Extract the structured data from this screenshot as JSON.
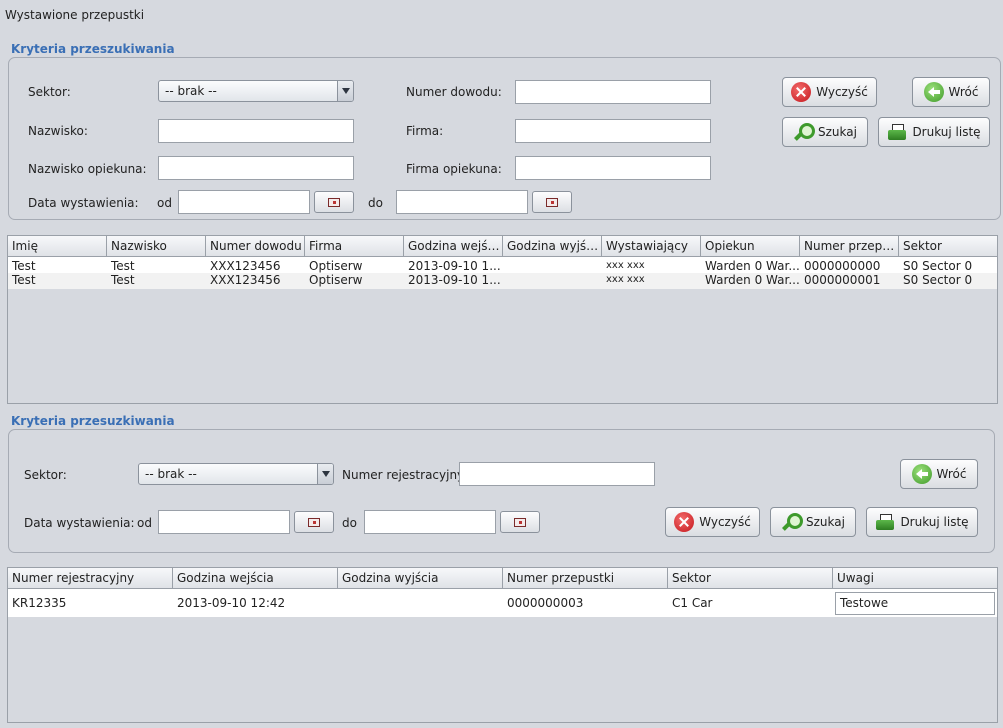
{
  "window": {
    "title": "Wystawione przepustki"
  },
  "passes_search": {
    "title": "Kryteria przeszukiwania",
    "sector_label": "Sektor:",
    "sector_value": "-- brak --",
    "surname_label": "Nazwisko:",
    "surname_value": "",
    "guardian_surname_label": "Nazwisko opiekuna:",
    "guardian_surname_value": "",
    "issue_date_label": "Data wystawienia:",
    "from_label": "od",
    "to_label": "do",
    "date_from": "",
    "date_to": "",
    "id_number_label": "Numer dowodu:",
    "id_number_value": "",
    "company_label": "Firma:",
    "company_value": "",
    "guardian_company_label": "Firma opiekuna:",
    "guardian_company_value": "",
    "clear_label": "Wyczyść",
    "back_label": "Wróć",
    "search_label": "Szukaj",
    "print_label": "Drukuj listę"
  },
  "passes_table": {
    "columns": [
      "Imię",
      "Nazwisko",
      "Numer dowodu",
      "Firma",
      "Godzina wejśc...",
      "Godzina wyjścia",
      "Wystawiający",
      "Opiekun",
      "Numer przepu...",
      "Sektor"
    ],
    "rows": [
      [
        "Test",
        "Test",
        "XXX123456",
        "Optiserw",
        "2013-09-10 1...",
        "",
        "xxx xxx",
        "Warden 0 War...",
        "0000000000",
        "S0 Sector 0"
      ],
      [
        "Test",
        "Test",
        "XXX123456",
        "Optiserw",
        "2013-09-10 1...",
        "",
        "xxx xxx",
        "Warden 0 War...",
        "0000000001",
        "S0 Sector 0"
      ]
    ]
  },
  "vehicle_search": {
    "title": "Kryteria przesuzkiwania",
    "sector_label": "Sektor:",
    "sector_value": "-- brak --",
    "plate_label": "Numer rejestracyjny",
    "plate_value": "",
    "issue_date_label": "Data wystawienia:",
    "from_label": "od",
    "to_label": "do",
    "date_from": "",
    "date_to": "",
    "back_label": "Wróć",
    "clear_label": "Wyczyść",
    "search_label": "Szukaj",
    "print_label": "Drukuj listę"
  },
  "vehicle_table": {
    "columns": [
      "Numer rejestracyjny",
      "Godzina wejścia",
      "Godzina wyjścia",
      "Numer przepustki",
      "Sektor",
      "Uwagi"
    ],
    "rows": [
      [
        "KR12335",
        "2013-09-10 12:42",
        "",
        "0000000003",
        "C1 Car",
        "Testowe"
      ]
    ]
  },
  "icons": {
    "clear": "clear-x-icon",
    "back": "back-arrow-icon",
    "search": "magnifier-icon",
    "print": "printer-icon",
    "calendar": "calendar-icon",
    "dropdown": "chevron-down-icon"
  },
  "colors": {
    "section_title": "#3a6fb5",
    "background": "#d6d9df"
  }
}
